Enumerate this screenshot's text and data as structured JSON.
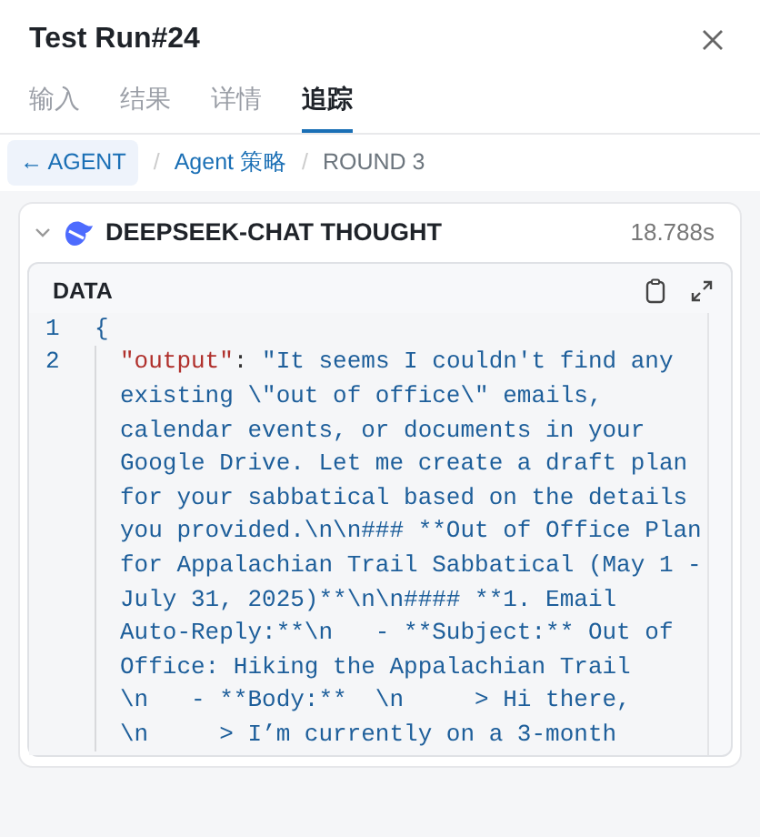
{
  "title": "Test Run#24",
  "tabs": [
    {
      "label": "输入",
      "selected": false
    },
    {
      "label": "结果",
      "selected": false
    },
    {
      "label": "详情",
      "selected": false
    },
    {
      "label": "追踪",
      "selected": true
    }
  ],
  "breadcrumb": {
    "back": "← AGENT",
    "separator": "/",
    "items": [
      "Agent 策略",
      "ROUND 3"
    ]
  },
  "step": {
    "expanded": true,
    "title": "DEEPSEEK-CHAT THOUGHT",
    "duration": "18.788s",
    "data": {
      "label": "DATA",
      "lines": [
        {
          "number": "1",
          "text": "{"
        },
        {
          "number": "2",
          "key": "\"output\"",
          "separator": ":",
          "rows": [
            "\"It seems I couldn't find any",
            "existing \\\"out of office\\\" emails,",
            "calendar events, or documents in your",
            "Google Drive. Let me create a draft plan",
            "for your sabbatical based on the details",
            "you provided.\\n\\n### **Out of Office Plan",
            "for Appalachian Trail Sabbatical (May 1 -",
            "July 31, 2025)**\\n\\n#### **1. Email",
            "Auto-Reply:**\\n   - **Subject:** Out of",
            "Office: Hiking the Appalachian Trail",
            "\\n   - **Body:**  \\n     > Hi there,",
            "\\n     > I’m currently on a 3-month"
          ]
        }
      ]
    }
  }
}
